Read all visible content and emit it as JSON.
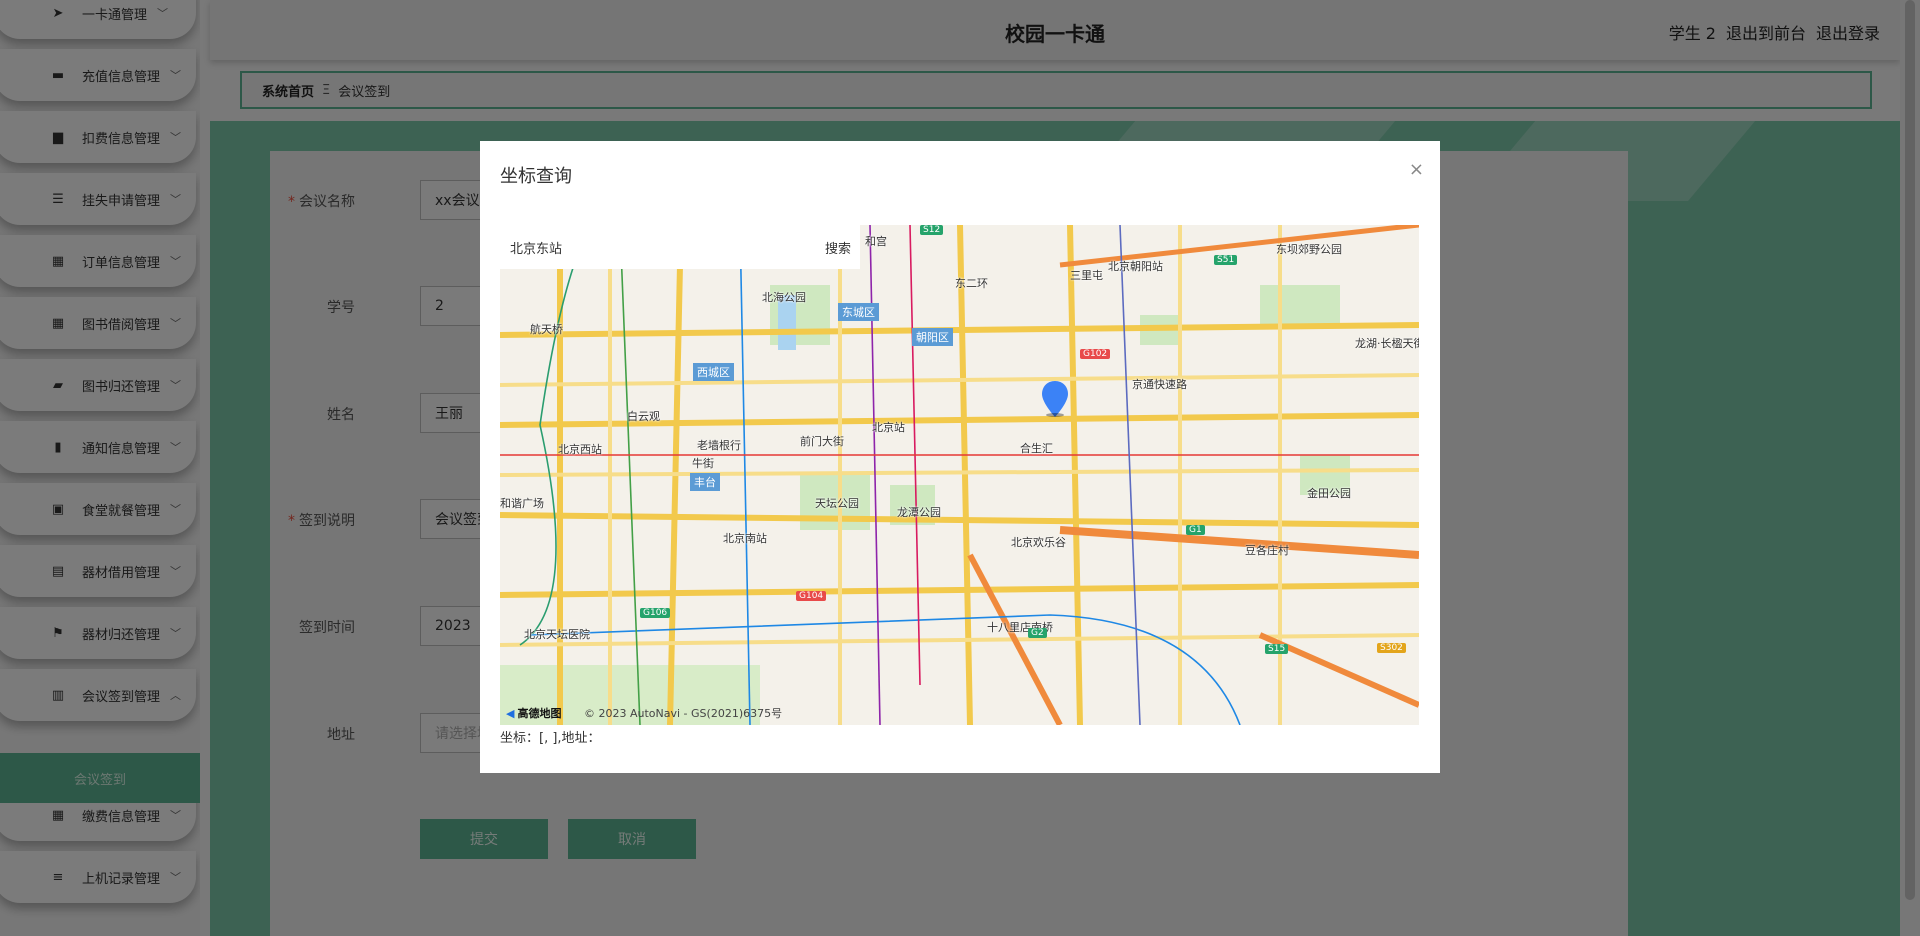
{
  "sidebar": {
    "items": [
      {
        "label": "一卡通管理",
        "icon": "paper-plane-icon",
        "glyph": "➤"
      },
      {
        "label": "充值信息管理",
        "icon": "monitor-icon",
        "glyph": "▬"
      },
      {
        "label": "扣费信息管理",
        "icon": "briefcase-icon",
        "glyph": "▆"
      },
      {
        "label": "挂失申请管理",
        "icon": "list-icon",
        "glyph": "☰"
      },
      {
        "label": "订单信息管理",
        "icon": "grid-icon",
        "glyph": "▦"
      },
      {
        "label": "图书借阅管理",
        "icon": "grid-icon",
        "glyph": "▦"
      },
      {
        "label": "图书归还管理",
        "icon": "ticket-icon",
        "glyph": "▰"
      },
      {
        "label": "通知信息管理",
        "icon": "bar-chart-icon",
        "glyph": "▮"
      },
      {
        "label": "食堂就餐管理",
        "icon": "calendar-x-icon",
        "glyph": "▣"
      },
      {
        "label": "器材借用管理",
        "icon": "clipboard-icon",
        "glyph": "▤"
      },
      {
        "label": "器材归还管理",
        "icon": "flag-icon",
        "glyph": "⚑"
      },
      {
        "label": "会议签到管理",
        "icon": "clipboard-check-icon",
        "glyph": "▥",
        "expanded": true
      },
      {
        "label": "缴费信息管理",
        "icon": "grid-icon",
        "glyph": "▦"
      },
      {
        "label": "上机记录管理",
        "icon": "sliders-icon",
        "glyph": "≡"
      }
    ],
    "active_sub": "会议签到"
  },
  "header": {
    "title": "校园一卡通",
    "user": "学生 2",
    "to_front": "退出到前台",
    "logout": "退出登录"
  },
  "breadcrumb": {
    "home": "系统首页",
    "sep": "Ξ",
    "current": "会议签到"
  },
  "form": {
    "fields": [
      {
        "label": "会议名称",
        "required": true,
        "value": "xx会议"
      },
      {
        "label": "学号",
        "required": false,
        "value": "2"
      },
      {
        "label": "姓名",
        "required": false,
        "value": "王丽"
      },
      {
        "label": "签到说明",
        "required": true,
        "value": "会议签到"
      },
      {
        "label": "签到时间",
        "required": false,
        "value": "2023"
      },
      {
        "label": "地址",
        "required": false,
        "placeholder": "请选择地址"
      }
    ],
    "submit": "提交",
    "cancel": "取消"
  },
  "modal": {
    "title": "坐标查询",
    "close": "×",
    "search": {
      "value": "北京东站",
      "button": "搜索"
    },
    "coords_text": "坐标：[, ],地址：",
    "map": {
      "districts": [
        "东城区",
        "西城区",
        "朝阳区",
        "丰台"
      ],
      "labels": [
        "北海公园",
        "航天桥",
        "白云观",
        "北京西站",
        "和谐广场",
        "天坛公园",
        "龙潭公园",
        "北京站",
        "前门大街",
        "牛街",
        "北京南站",
        "北京天坛医院",
        "合生汇",
        "北京欢乐谷",
        "十八里店南桥",
        "豆各庄村",
        "金田公园",
        "北京朝阳站",
        "东坝郊野公园",
        "龙湖·长楹天街",
        "京通快速路",
        "三里屯",
        "东二环",
        "和宫",
        "老墙根行"
      ],
      "roads": [
        "G102",
        "G104",
        "G106",
        "G1",
        "G2",
        "S51",
        "S15",
        "S302",
        "S12"
      ],
      "logo": "高德地图",
      "copyright": "© 2023 AutoNavi - GS(2021)6375号"
    }
  }
}
